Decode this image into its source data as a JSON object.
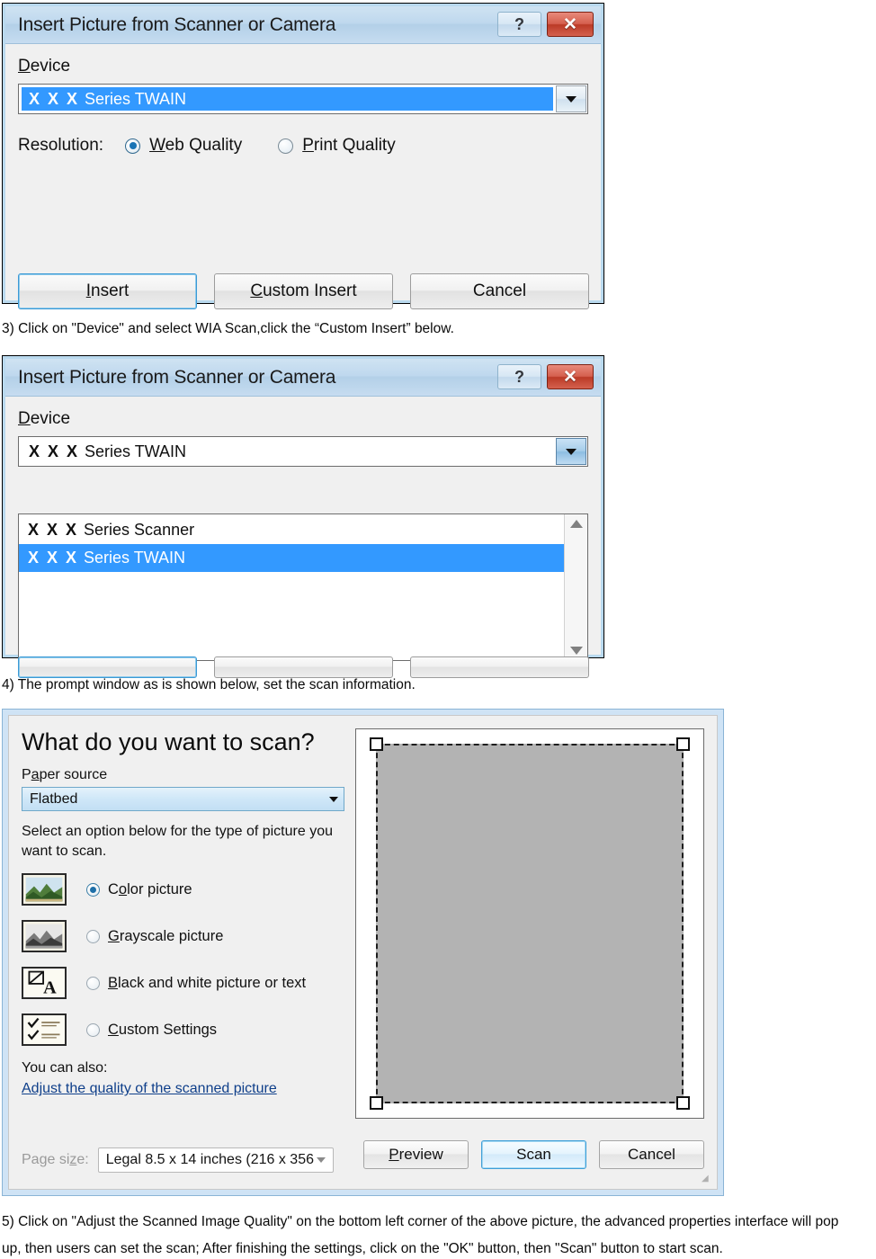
{
  "dialog1": {
    "title": "Insert Picture from Scanner or Camera",
    "help_label": "?",
    "close_label": "✕",
    "device_label": "Device",
    "device_value_prefix": "X X X",
    "device_value": "Series TWAIN",
    "resolution_label": "Resolution:",
    "radio_web": "Web Quality",
    "radio_print": "Print Quality",
    "selected_resolution": "Web Quality",
    "buttons": {
      "insert": "Insert",
      "custom_insert": "Custom Insert",
      "cancel": "Cancel"
    }
  },
  "caption3": "3) Click on \"Device\" and select WIA Scan,click the “Custom Insert” below.",
  "dialog2": {
    "title": "Insert Picture from Scanner or Camera",
    "help_label": "?",
    "close_label": "✕",
    "device_label": "Device",
    "device_value_prefix": "X X X",
    "device_value": "Series TWAIN",
    "options": [
      {
        "prefix": "X X X",
        "label": "Series Scanner",
        "selected": false
      },
      {
        "prefix": "X X X",
        "label": "Series TWAIN",
        "selected": true
      }
    ]
  },
  "caption4": "4) The prompt window as is shown below, set the scan information.",
  "wia": {
    "heading": "What do you want to scan?",
    "paper_source_label": "Paper source",
    "paper_source_value": "Flatbed",
    "description": "Select an option below for the type of picture you want to scan.",
    "scan_types": [
      {
        "label": "Color picture",
        "selected": true,
        "icon": "color-picture-icon"
      },
      {
        "label": "Grayscale picture",
        "selected": false,
        "icon": "grayscale-picture-icon"
      },
      {
        "label": "Black and white picture or text",
        "selected": false,
        "icon": "bw-picture-icon"
      },
      {
        "label": "Custom Settings",
        "selected": false,
        "icon": "custom-settings-icon"
      }
    ],
    "you_can_also_label": "You can also:",
    "adjust_link": "Adjust the quality of the scanned picture",
    "page_size_label": "Page size:",
    "page_size_value": "Legal 8.5 x 14 inches (216 x 356",
    "buttons": {
      "preview": "Preview",
      "scan": "Scan",
      "cancel": "Cancel"
    }
  },
  "caption5_line1": "5) Click on \"Adjust the Scanned Image Quality\" on the bottom left corner of the above picture, the advanced properties interface will pop",
  "caption5_line2": "up, then users can set the scan; After finishing the settings, click on the \"OK\" button, then \"Scan\" button to start scan."
}
